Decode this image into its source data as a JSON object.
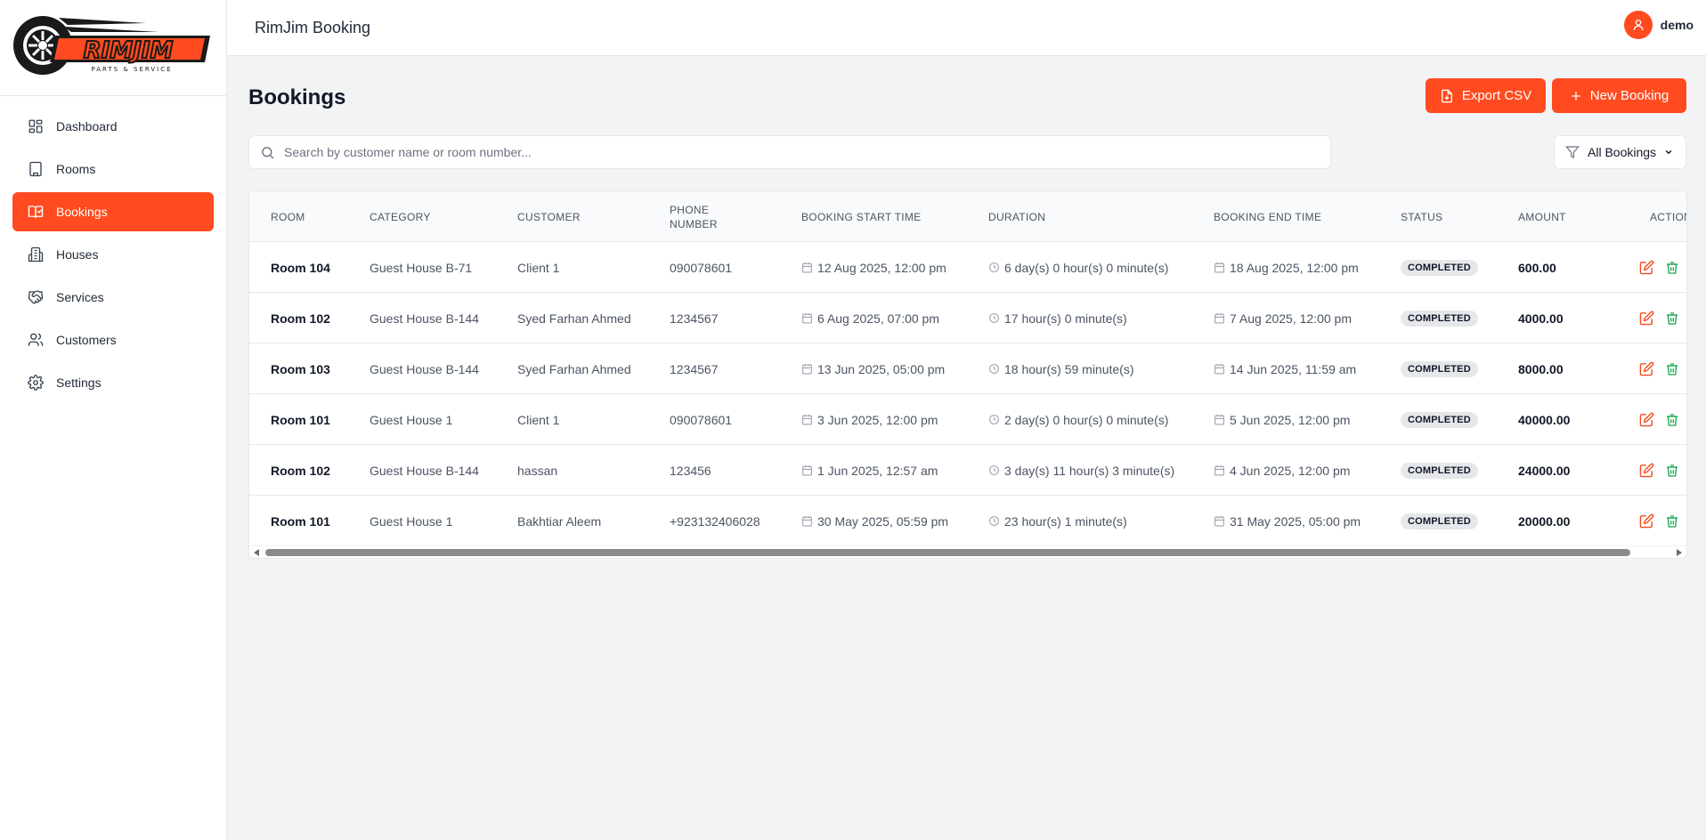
{
  "brand": {
    "logo_text": "RIMJIM",
    "logo_sub": "PARTS & SERVICE"
  },
  "header": {
    "title": "RimJim Booking",
    "username": "demo"
  },
  "sidebar": {
    "items": [
      {
        "label": "Dashboard",
        "icon": "dashboard-icon"
      },
      {
        "label": "Rooms",
        "icon": "building-icon"
      },
      {
        "label": "Bookings",
        "icon": "book-icon",
        "active": true
      },
      {
        "label": "Houses",
        "icon": "houses-icon"
      },
      {
        "label": "Services",
        "icon": "handshake-icon"
      },
      {
        "label": "Customers",
        "icon": "users-icon"
      },
      {
        "label": "Settings",
        "icon": "gear-icon"
      }
    ]
  },
  "page": {
    "title": "Bookings",
    "export_label": "Export CSV",
    "new_label": "New Booking",
    "search_placeholder": "Search by customer name or room number...",
    "filter_label": "All Bookings"
  },
  "table": {
    "columns": [
      "ROOM",
      "CATEGORY",
      "CUSTOMER",
      "PHONE\nNUMBER",
      "BOOKING START TIME",
      "DURATION",
      "BOOKING END TIME",
      "STATUS",
      "AMOUNT",
      "ACTIONS"
    ],
    "rows": [
      {
        "room": "Room 104",
        "category": "Guest House B-71",
        "customer": "Client 1",
        "phone": "090078601",
        "start": "12 Aug 2025, 12:00 pm",
        "duration": "6 day(s) 0 hour(s) 0 minute(s)",
        "end": "18 Aug 2025, 12:00 pm",
        "status": "COMPLETED",
        "amount": "600.00"
      },
      {
        "room": "Room 102",
        "category": "Guest House B-144",
        "customer": "Syed Farhan Ahmed",
        "phone": "1234567",
        "start": "6 Aug 2025, 07:00 pm",
        "duration": "17 hour(s) 0 minute(s)",
        "end": "7 Aug 2025, 12:00 pm",
        "status": "COMPLETED",
        "amount": "4000.00"
      },
      {
        "room": "Room 103",
        "category": "Guest House B-144",
        "customer": "Syed Farhan Ahmed",
        "phone": "1234567",
        "start": "13 Jun 2025, 05:00 pm",
        "duration": "18 hour(s) 59 minute(s)",
        "end": "14 Jun 2025, 11:59 am",
        "status": "COMPLETED",
        "amount": "8000.00"
      },
      {
        "room": "Room 101",
        "category": "Guest House 1",
        "customer": "Client 1",
        "phone": "090078601",
        "start": "3 Jun 2025, 12:00 pm",
        "duration": "2 day(s) 0 hour(s) 0 minute(s)",
        "end": "5 Jun 2025, 12:00 pm",
        "status": "COMPLETED",
        "amount": "40000.00"
      },
      {
        "room": "Room 102",
        "category": "Guest House B-144",
        "customer": "hassan",
        "phone": "123456",
        "start": "1 Jun 2025, 12:57 am",
        "duration": "3 day(s) 11 hour(s) 3 minute(s)",
        "end": "4 Jun 2025, 12:00 pm",
        "status": "COMPLETED",
        "amount": "24000.00"
      },
      {
        "room": "Room 101",
        "category": "Guest House 1",
        "customer": "Bakhtiar Aleem",
        "phone": "+923132406028",
        "start": "30 May 2025, 05:59 pm",
        "duration": "23 hour(s) 1 minute(s)",
        "end": "31 May 2025, 05:00 pm",
        "status": "COMPLETED",
        "amount": "20000.00"
      }
    ]
  },
  "colors": {
    "accent": "#ff4b1f",
    "edit": "#ef4b1f",
    "delete": "#16a34a",
    "invoice": "#ef4b1f"
  }
}
